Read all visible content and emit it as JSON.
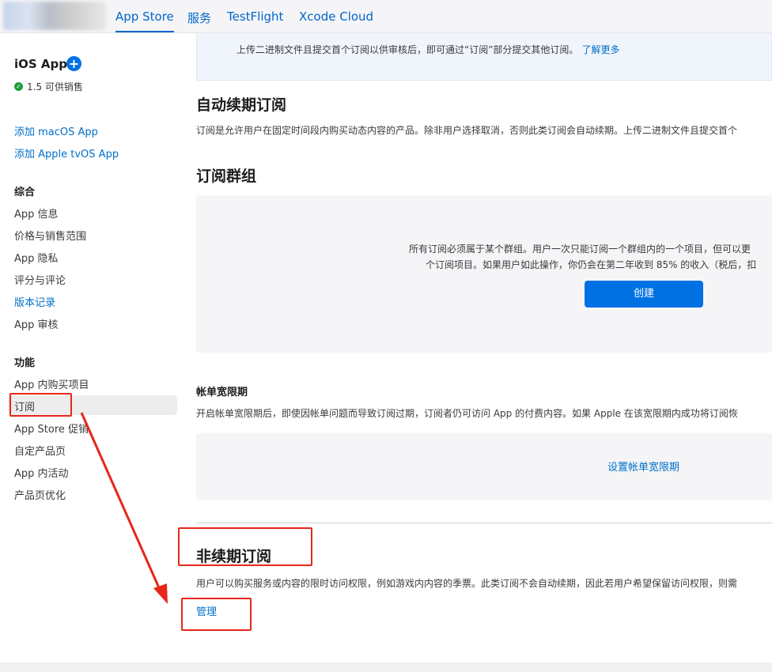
{
  "header": {
    "tabs": [
      {
        "label": "App Store",
        "active": true
      },
      {
        "label": "服务"
      },
      {
        "label": "TestFlight"
      },
      {
        "label": "Xcode Cloud"
      }
    ]
  },
  "sidebar": {
    "app_name": "iOS App",
    "add_icon": "plus-circle-icon",
    "status": "1.5 可供销售",
    "add_links": [
      "添加 macOS App",
      "添加 Apple tvOS App"
    ],
    "sections": [
      {
        "title": "综合",
        "items": [
          "App 信息",
          "价格与销售范围",
          "App 隐私",
          "评分与评论",
          "版本记录",
          "App 审核"
        ]
      },
      {
        "title": "功能",
        "items": [
          "App 内购买项目",
          "订阅",
          "App Store 促销",
          "自定产品页",
          "App 内活动",
          "产品页优化"
        ]
      }
    ]
  },
  "main": {
    "banner": {
      "text": "上传二进制文件且提交首个订阅以供审核后，即可通过“订阅”部分提交其他订阅。",
      "link": "了解更多"
    },
    "auto_renew": {
      "title": "自动续期订阅",
      "desc": "订阅是允许用户在固定时间段内购买动态内容的产品。除非用户选择取消，否则此类订阅会自动续期。上传二进制文件且提交首个"
    },
    "groups": {
      "title": "订阅群组",
      "line1": "所有订阅必须属于某个群组。用户一次只能订阅一个群组内的一个项目，但可以更",
      "line2": "个订阅项目。如果用户如此操作，你仍会在第二年收到 85% 的收入（税后，扣",
      "button": "创建"
    },
    "grace": {
      "title": "帐单宽限期",
      "desc": "开启帐单宽限期后，即使因帐单问题而导致订阅过期，订阅者仍可访问 App 的付费内容。如果 Apple 在该宽限期内成功将订阅恢",
      "link": "设置帐单宽限期"
    },
    "non_renew": {
      "title": "非续期订阅",
      "desc": "用户可以购买服务或内容的限时访问权限，例如游戏内内容的季票。此类订阅不会自动续期，因此若用户希望保留访问权限，则需",
      "link": "管理"
    }
  },
  "colors": {
    "accent": "#0071e3",
    "link": "#0070c9",
    "annotation": "#e6271b"
  }
}
